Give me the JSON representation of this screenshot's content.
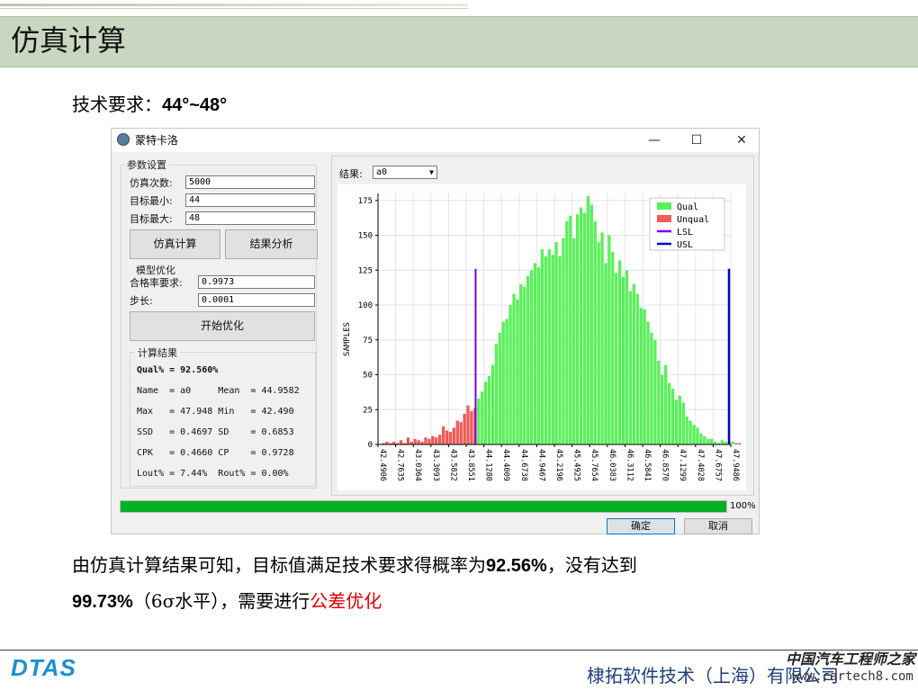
{
  "slide": {
    "title": "仿真计算",
    "requirement_label": "技术要求：",
    "requirement_value": "44°~48°",
    "conclusion_line1_a": "由仿真计算结果可知，目标值满足技术要求得概率为",
    "conclusion_line1_b": "92.56%",
    "conclusion_line1_c": "，没有达到",
    "conclusion_line2_a": "99.73%",
    "conclusion_line2_b": "（6σ水平），需要进行",
    "conclusion_line2_c": "公差优化",
    "company": "棣拓软件技术（上海）有限公司",
    "logo": "DTAS",
    "watermark_1": "中国汽车工程师之家",
    "watermark_2": "www.cartech8.com"
  },
  "window": {
    "title": "蒙特卡洛",
    "min_glyph": "—",
    "max_glyph": "☐",
    "close_glyph": "✕"
  },
  "params": {
    "group_label": "参数设置",
    "sim_count_label": "仿真次数:",
    "sim_count_value": "5000",
    "target_min_label": "目标最小:",
    "target_min_value": "44",
    "target_max_label": "目标最大:",
    "target_max_value": "48",
    "simulate_button": "仿真计算",
    "analyze_button": "结果分析"
  },
  "optimize": {
    "group_label": "模型优化",
    "pass_rate_label": "合格率要求:",
    "pass_rate_value": "0.9973",
    "step_label": "步长:",
    "step_value": "0.0001",
    "start_button": "开始优化"
  },
  "results": {
    "group_label": "计算结果",
    "qual_line": "Qual% = 92.560%",
    "rows": [
      "Name  = a0     Mean  = 44.9582",
      "Max   = 47.948 Min   = 42.490",
      "SSD   = 0.4697 SD    = 0.6853",
      "CPK   = 0.4660 CP    = 0.9728",
      "Lout% = 7.44%  Rout% = 0.00%"
    ]
  },
  "result_select": {
    "label": "结果:",
    "value": "a0"
  },
  "progress": {
    "value": 1.0,
    "label": "100%"
  },
  "dialog_buttons": {
    "ok": "确定",
    "cancel": "取消"
  },
  "colors": {
    "qual": "#5af05a",
    "unqual": "#f05a5a",
    "lsl": "#7a00e0",
    "usl": "#0000cc",
    "accent": "#e00000"
  },
  "chart_data": {
    "type": "bar",
    "ylabel": "SAMPLES",
    "xlabel": "",
    "ylim": [
      0,
      180
    ],
    "yticks": [
      0,
      25,
      50,
      75,
      100,
      125,
      150,
      175
    ],
    "xlim": [
      42.49,
      47.948
    ],
    "xticks": [
      "42.4906",
      "42.7635",
      "43.0364",
      "43.3093",
      "43.5822",
      "43.8551",
      "44.1280",
      "44.4009",
      "44.6738",
      "44.9467",
      "45.2196",
      "45.4925",
      "45.7654",
      "46.0383",
      "46.3112",
      "46.5841",
      "46.8570",
      "47.1299",
      "47.4028",
      "47.6757",
      "47.9486"
    ],
    "bin_start": 42.4906,
    "bin_width": 0.0546,
    "lsl": 44.0,
    "usl": 48.0,
    "limit_line_height": 126,
    "values": [
      0,
      1,
      2,
      1,
      2,
      1,
      3,
      1,
      5,
      2,
      4,
      3,
      2,
      5,
      4,
      6,
      5,
      7,
      13,
      10,
      9,
      12,
      17,
      16,
      22,
      28,
      24,
      26,
      33,
      38,
      45,
      49,
      57,
      72,
      80,
      88,
      90,
      100,
      108,
      104,
      115,
      113,
      121,
      125,
      130,
      127,
      140,
      135,
      140,
      136,
      145,
      135,
      148,
      160,
      164,
      148,
      165,
      170,
      166,
      178,
      172,
      160,
      145,
      152,
      130,
      150,
      138,
      123,
      132,
      120,
      125,
      110,
      115,
      108,
      98,
      97,
      88,
      80,
      75,
      60,
      50,
      57,
      44,
      40,
      32,
      35,
      30,
      20,
      17,
      14,
      12,
      8,
      6,
      4,
      4,
      2,
      1,
      3,
      2,
      2,
      2,
      1,
      1,
      0,
      0,
      1,
      0
    ],
    "legend": {
      "position": "top-right",
      "entries": [
        "Qual",
        "Unqual",
        "LSL",
        "USL"
      ]
    }
  }
}
